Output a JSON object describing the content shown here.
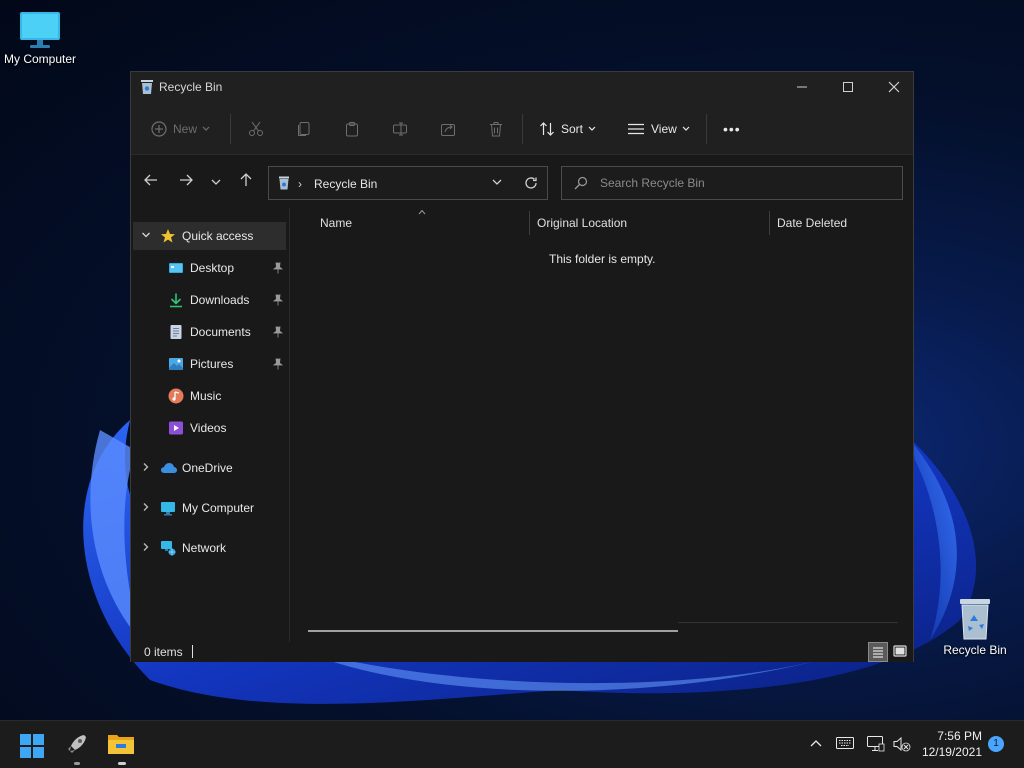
{
  "desktop": {
    "icons": [
      {
        "label": "My Computer"
      },
      {
        "label": "Recycle Bin"
      }
    ]
  },
  "window": {
    "title": "Recycle Bin",
    "toolbar": {
      "new_label": "New",
      "sort_label": "Sort",
      "view_label": "View",
      "more_label": "•••"
    },
    "address": {
      "crumb": "Recycle Bin",
      "separator": "›"
    },
    "search": {
      "placeholder": "Search Recycle Bin"
    },
    "sidebar": {
      "quick_access": "Quick access",
      "items": [
        {
          "label": "Desktop",
          "icon": "desktop-icon",
          "pinned": true
        },
        {
          "label": "Downloads",
          "icon": "download-icon",
          "pinned": true
        },
        {
          "label": "Documents",
          "icon": "document-icon",
          "pinned": true
        },
        {
          "label": "Pictures",
          "icon": "picture-icon",
          "pinned": true
        },
        {
          "label": "Music",
          "icon": "music-icon",
          "pinned": false
        },
        {
          "label": "Videos",
          "icon": "video-icon",
          "pinned": false
        }
      ],
      "roots": [
        {
          "label": "OneDrive",
          "icon": "cloud-icon"
        },
        {
          "label": "My Computer",
          "icon": "computer-icon"
        },
        {
          "label": "Network",
          "icon": "network-icon"
        }
      ]
    },
    "columns": [
      "Name",
      "Original Location",
      "Date Deleted"
    ],
    "empty_message": "This folder is empty.",
    "status": {
      "item_count": "0 items"
    }
  },
  "taskbar": {
    "time": "7:56 PM",
    "date": "12/19/2021",
    "notifications": "1"
  },
  "colors": {
    "accent": "#0078d4",
    "folder": "#f3c338",
    "onedrive": "#3a8fe0"
  }
}
